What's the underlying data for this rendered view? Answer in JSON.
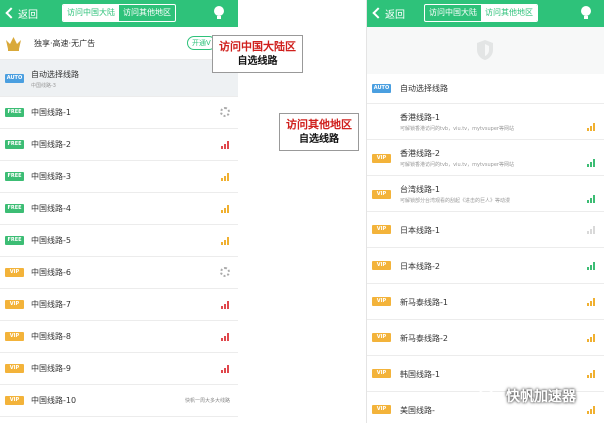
{
  "left": {
    "back": "返回",
    "tabs": [
      "访问中国大陆",
      "访问其他地区"
    ],
    "promo": "独享·高速·无广告",
    "promo_button": "开通V",
    "auto": {
      "badge": "AUTO",
      "name": "自动选择线路",
      "sub": "中国线路-3"
    },
    "rows": [
      {
        "badge": "FREE",
        "name": "中国线路-1",
        "status": "loading"
      },
      {
        "badge": "FREE",
        "name": "中国线路-2",
        "status": "signal",
        "color": "#e0474c"
      },
      {
        "badge": "FREE",
        "name": "中国线路-3",
        "status": "signal",
        "color": "#f0b030"
      },
      {
        "badge": "FREE",
        "name": "中国线路-4",
        "status": "signal",
        "color": "#f0b030"
      },
      {
        "badge": "FREE",
        "name": "中国线路-5",
        "status": "signal",
        "color": "#f0b030"
      },
      {
        "badge": "VIP",
        "name": "中国线路-6",
        "status": "loading"
      },
      {
        "badge": "VIP",
        "name": "中国线路-7",
        "status": "signal",
        "color": "#e0474c"
      },
      {
        "badge": "VIP",
        "name": "中国线路-8",
        "status": "signal",
        "color": "#e0474c"
      },
      {
        "badge": "VIP",
        "name": "中国线路-9",
        "status": "signal",
        "color": "#e0474c"
      },
      {
        "badge": "VIP",
        "name": "中国线路-10",
        "status": "note",
        "note": "快帆一周大多大线路"
      }
    ]
  },
  "right": {
    "back": "返回",
    "tabs": [
      "访问中国大陆",
      "访问其他地区"
    ],
    "auto": {
      "badge": "AUTO",
      "name": "自动选择线路"
    },
    "rows": [
      {
        "badge": "",
        "name": "香港线路-1",
        "sub": "可解锁香港访问的tvb，viu.tv，mytvsuper等网站",
        "color": "#f0b030"
      },
      {
        "badge": "VIP",
        "name": "香港线路-2",
        "sub": "可解锁香港访问的tvb，viu.tv，mytvsuper等网站",
        "color": "#3cbd74"
      },
      {
        "badge": "VIP",
        "name": "台湾线路-1",
        "sub": "可解锁部分台湾观看的刮起《进击的巨人》等动漫",
        "color": "#3cbd74"
      },
      {
        "badge": "VIP",
        "name": "日本线路-1",
        "sub": "",
        "color": "#d9d9d9"
      },
      {
        "badge": "VIP",
        "name": "日本线路-2",
        "sub": "",
        "color": "#3cbd74"
      },
      {
        "badge": "VIP",
        "name": "新马泰线路-1",
        "sub": "",
        "color": "#f0b030"
      },
      {
        "badge": "VIP",
        "name": "新马泰线路-2",
        "sub": "",
        "color": "#f0b030"
      },
      {
        "badge": "VIP",
        "name": "韩国线路-1",
        "sub": "",
        "color": "#f0b030"
      },
      {
        "badge": "VIP",
        "name": "美国线路-",
        "sub": "",
        "color": "#f0b030"
      }
    ]
  },
  "annotations": [
    {
      "line1": "访问中国大陆区",
      "line2": "自选线路"
    },
    {
      "line1": "访问其他地区",
      "line2": "自选线路"
    }
  ],
  "watermark": "快帆加速器",
  "colors": {
    "brand_green": "#2ec27a",
    "free": "#3cbd74",
    "vip": "#f3b33a",
    "auto": "#4a9fe0",
    "highlight_red": "#d0201d"
  }
}
